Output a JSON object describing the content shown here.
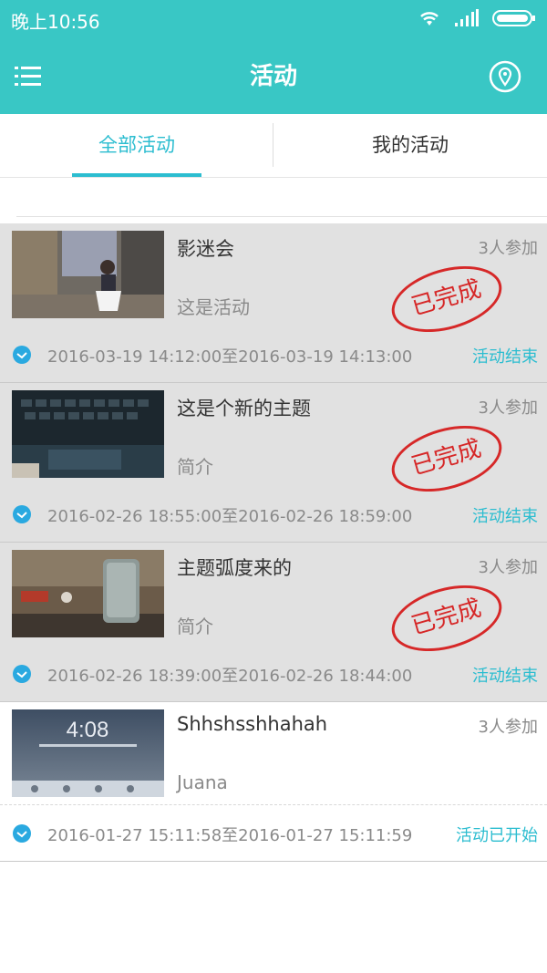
{
  "status_bar": {
    "time": "晚上10:56"
  },
  "header": {
    "title": "活动",
    "menu_icon": "menu-icon",
    "location_icon": "location-pin-icon"
  },
  "tabs": [
    {
      "label": "全部活动",
      "active": true
    },
    {
      "label": "我的活动",
      "active": false
    }
  ],
  "colors": {
    "header_bg": "#39c7c5",
    "accent": "#2cbdd0",
    "stamp_red": "#d62828",
    "completed_bg": "#e1e1e1"
  },
  "activities": [
    {
      "title": "影迷会",
      "participants": "3人参加",
      "desc": "这是活动",
      "time_range": "2016-03-19 14:12:00至2016-03-19 14:13:00",
      "status": "活动结束",
      "stamp": "已完成"
    },
    {
      "title": "这是个新的主题",
      "participants": "3人参加",
      "desc": "简介",
      "time_range": "2016-02-26 18:55:00至2016-02-26 18:59:00",
      "status": "活动结束",
      "stamp": "已完成"
    },
    {
      "title": "主题弧度来的",
      "participants": "3人参加",
      "desc": "简介",
      "time_range": "2016-02-26 18:39:00至2016-02-26 18:44:00",
      "status": "活动结束",
      "stamp": "已完成"
    },
    {
      "title": "Shhshsshhahah",
      "participants": "3人参加",
      "desc": "Juana",
      "time_range": "2016-01-27 15:11:58至2016-01-27 15:11:59",
      "status": "活动已开始",
      "thumb_text": "4:08"
    }
  ]
}
